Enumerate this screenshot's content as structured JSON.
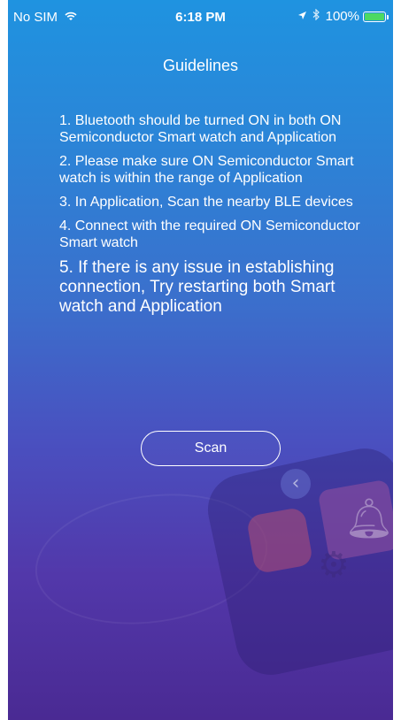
{
  "status_bar": {
    "carrier": "No SIM",
    "time": "6:18 PM",
    "battery": "100%",
    "icons": [
      "wifi-icon",
      "location-icon",
      "bluetooth-icon",
      "battery-icon"
    ]
  },
  "screen": {
    "title": "Guidelines",
    "guidelines": [
      "1. Bluetooth should be turned ON in both ON Semiconductor Smart watch and Application",
      "2. Please make sure ON Semiconductor Smart watch is within the range of Application",
      "3. In Application, Scan the nearby BLE devices",
      "4. Connect with the required ON Semiconductor Smart watch",
      "5. If there is any issue in establishing connection, Try restarting both Smart watch and Application"
    ],
    "scan_button_label": "Scan"
  },
  "colors": {
    "gradient_top": "#1f93e0",
    "gradient_bottom": "#4a2a93",
    "battery_fill": "#4cd964",
    "text": "#ffffff"
  }
}
